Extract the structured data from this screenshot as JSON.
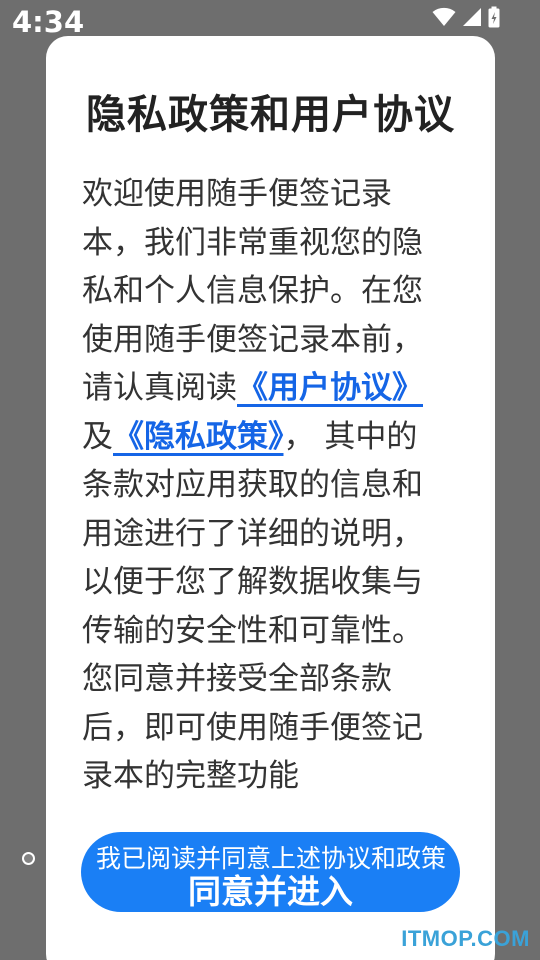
{
  "status_bar": {
    "time": "4:34",
    "icons": [
      "wifi-icon",
      "signal-icon",
      "battery-icon"
    ],
    "text_color": "#ffffff"
  },
  "dialog": {
    "title": "隐私政策和用户协议",
    "body": {
      "intro": "欢迎使用随手便签记录本，我们非常重视您的隐私和个人信息保护。在您使用随手便签记录本前，请认真阅读",
      "user_agreement_link": "《用户协议》",
      "conjunction": "及",
      "privacy_policy_link": "《隐私政策》",
      "rest": "， 其中的条款对应用获取的信息和用途进行了详细的说明，以便于您了解数据收集与传输的安全性和可靠性。您同意并接受全部条款后，即可使用随手便签记录本的完整功能"
    },
    "consent_label": "我已阅读并同意上述协议和政策",
    "agree_button_label": "同意并进入"
  },
  "watermark": "ITMOP.COM",
  "colors": {
    "accent": "#1a7ff5",
    "link": "#1565e6",
    "overlay": "#6e6e6e",
    "watermark": "#3aa2d8"
  }
}
